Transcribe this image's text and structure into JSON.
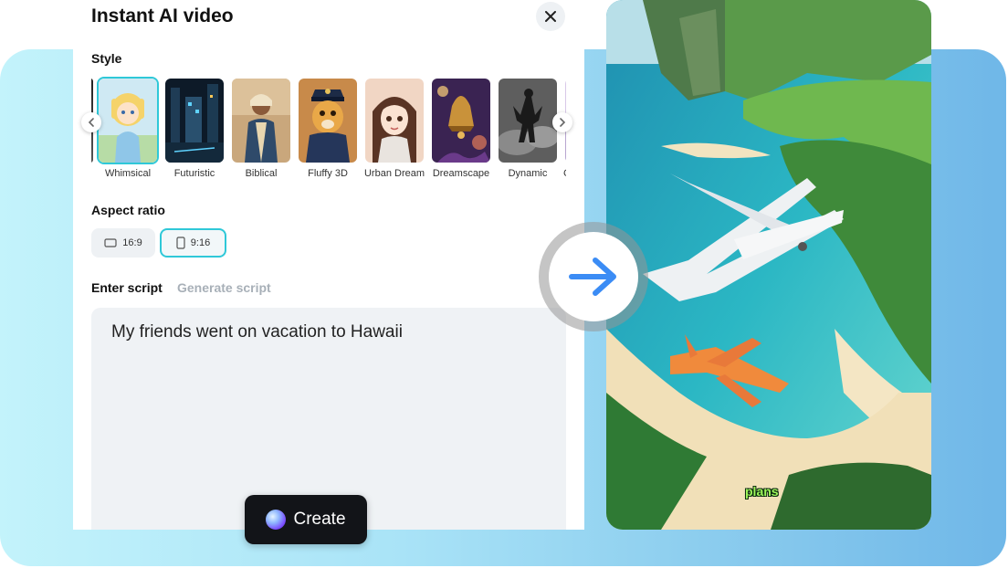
{
  "dialog": {
    "title": "Instant AI video",
    "close_icon": "close-icon"
  },
  "style_section": {
    "label": "Style",
    "items": [
      {
        "label": "Whimsical",
        "selected": true
      },
      {
        "label": "Futuristic",
        "selected": false
      },
      {
        "label": "Biblical",
        "selected": false
      },
      {
        "label": "Fluffy 3D",
        "selected": false
      },
      {
        "label": "Urban Dream",
        "selected": false
      },
      {
        "label": "Dreamscape",
        "selected": false
      },
      {
        "label": "Dynamic",
        "selected": false
      },
      {
        "label": "C",
        "selected": false
      }
    ],
    "prev_icon": "chevron-left-icon",
    "next_icon": "chevron-right-icon"
  },
  "aspect_section": {
    "label": "Aspect ratio",
    "options": [
      {
        "label": "16:9",
        "icon": "landscape-icon",
        "selected": false
      },
      {
        "label": "9:16",
        "icon": "portrait-icon",
        "selected": true
      }
    ]
  },
  "script_section": {
    "tabs": [
      {
        "label": "Enter script",
        "active": true
      },
      {
        "label": "Generate script",
        "active": false
      }
    ],
    "value": "My friends went on vacation to Hawaii"
  },
  "create_button": {
    "label": "Create"
  },
  "preview": {
    "caption": "plans"
  },
  "colors": {
    "accent": "#2fc8d8",
    "arrow": "#3b8cf5",
    "create_bg": "#121418"
  }
}
